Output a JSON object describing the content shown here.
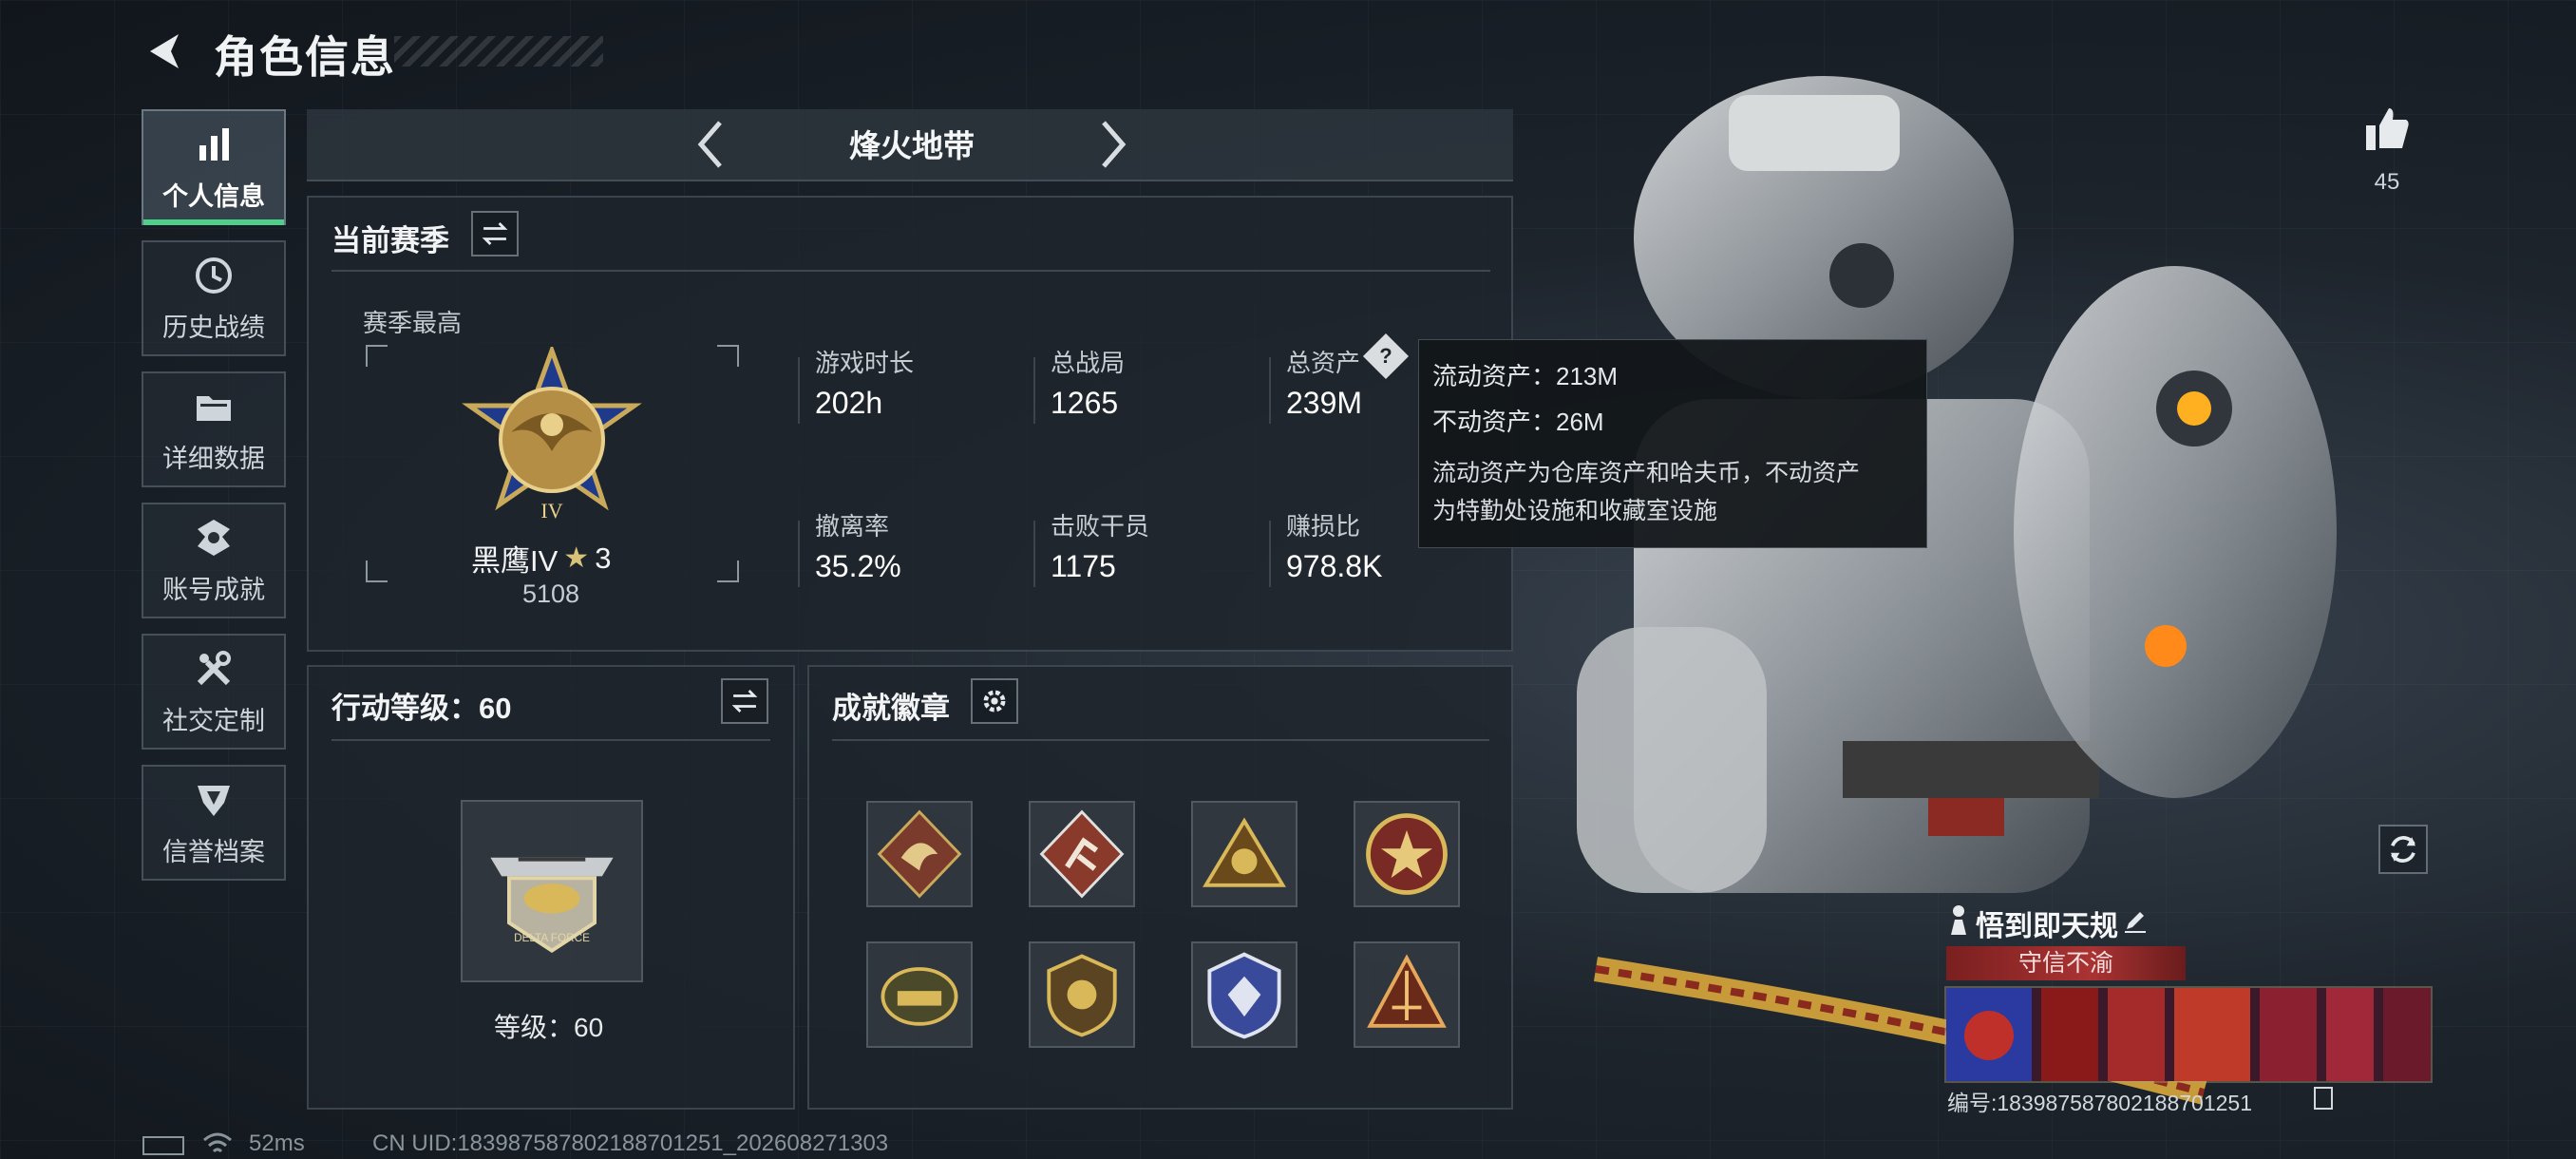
{
  "header": {
    "title": "角色信息"
  },
  "sidebar": {
    "items": [
      {
        "label": "个人信息",
        "icon": "bar-chart-icon",
        "active": true
      },
      {
        "label": "历史战绩",
        "icon": "clock-history-icon",
        "active": false
      },
      {
        "label": "详细数据",
        "icon": "folder-icon",
        "active": false
      },
      {
        "label": "账号成就",
        "icon": "achievement-badge-icon",
        "active": false
      },
      {
        "label": "社交定制",
        "icon": "tools-icon",
        "active": false
      },
      {
        "label": "信誉档案",
        "icon": "shield-emblem-icon",
        "active": false
      }
    ]
  },
  "mode": {
    "title": "烽火地带"
  },
  "season": {
    "panel_title": "当前赛季",
    "best_label": "赛季最高",
    "rank_name": "黑鹰IV",
    "rank_stars": "3",
    "rank_points": "5108",
    "stats": [
      {
        "label": "游戏时长",
        "value": "202h"
      },
      {
        "label": "总战局",
        "value": "1265"
      },
      {
        "label": "总资产",
        "value": "239M"
      },
      {
        "label": "撤离率",
        "value": "35.2%"
      },
      {
        "label": "击败干员",
        "value": "1175"
      },
      {
        "label": "赚损比",
        "value": "978.8K"
      }
    ]
  },
  "tooltip": {
    "liquid": "流动资产：213M",
    "fixed": "不动资产：26M",
    "desc_line1": "流动资产为仓库资产和哈夫币，不动资产",
    "desc_line2": "为特勤处设施和收藏室设施"
  },
  "action_level": {
    "panel_title": "行动等级：60",
    "level_label": "等级：60"
  },
  "badges": {
    "panel_title": "成就徽章"
  },
  "profile": {
    "likes": "45",
    "player_name": "悟到即天规",
    "title_tag": "守信不渝",
    "uid": "编号:1839875878021887012​51"
  },
  "status": {
    "ping": "52ms",
    "uid": "CN UID:1839875878021887012​51_202608271303"
  },
  "colors": {
    "accent_green": "#4ed08a",
    "title_red": "#a33333",
    "gold": "#c9a95a"
  }
}
